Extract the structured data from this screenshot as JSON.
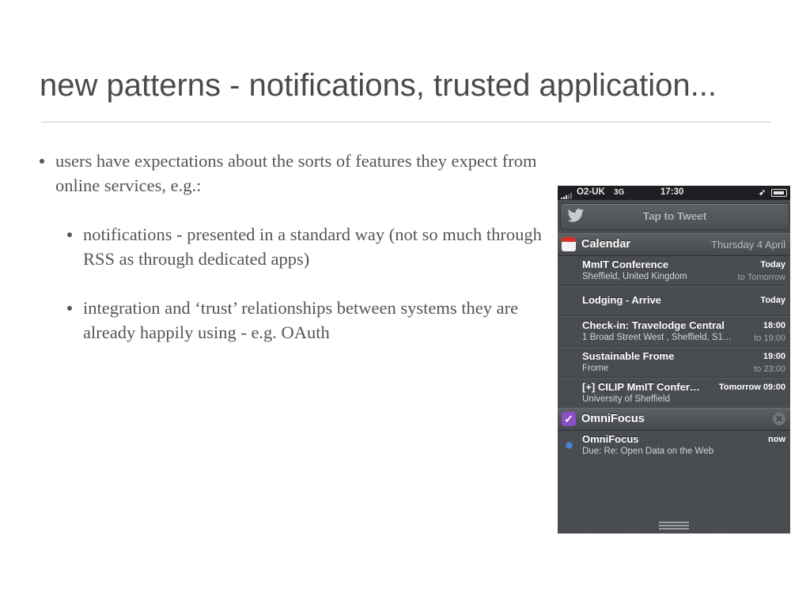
{
  "slide": {
    "title": "new patterns - notifications, trusted application...",
    "bullets": {
      "main": "users have expectations about the sorts of features they expect from online services, e.g.:",
      "sub1": "notifications - presented in a standard way (not so much through RSS as through dedicated apps)",
      "sub2": "integration and ‘trust’ relationships between systems they are already happily using - e.g. OAuth"
    }
  },
  "phone": {
    "status": {
      "carrier": "O2-UK",
      "network": "3G",
      "time": "17:30",
      "location_icon": "location-arrow-icon",
      "battery_icon": "battery-charging-icon"
    },
    "tweet_bar": {
      "label": "Tap to Tweet",
      "icon": "twitter-bird-icon"
    },
    "calendar": {
      "title": "Calendar",
      "date": "Thursday 4 April",
      "icon": "calendar-icon",
      "events": [
        {
          "title": "MmIT Conference",
          "subtitle": "Sheffield, United Kingdom",
          "time": "Today",
          "until": "to Tomorrow"
        },
        {
          "title": "Lodging - Arrive",
          "subtitle": "",
          "time": "Today",
          "until": ""
        },
        {
          "title": "Check-in: Travelodge Central",
          "subtitle": "1 Broad Street West , Sheffield, S1…",
          "time": "18:00",
          "until": "to 19:00"
        },
        {
          "title": "Sustainable Frome",
          "subtitle": "Frome",
          "time": "19:00",
          "until": "to 23:00"
        },
        {
          "title": "[+] CILIP MmIT Confer…",
          "subtitle": "University of Sheffield",
          "time": "Tomorrow 09:00",
          "until": ""
        }
      ]
    },
    "omnifocus": {
      "title": "OmniFocus",
      "icon": "checkmark-icon",
      "item": {
        "title": "OmniFocus",
        "subtitle": "Due: Re: Open Data on the Web",
        "time": "now"
      }
    },
    "colors": {
      "unread_dot": "#3f86e8",
      "calendar_red": "#d4322c",
      "omnifocus_purple": "#8b4fc3"
    }
  }
}
